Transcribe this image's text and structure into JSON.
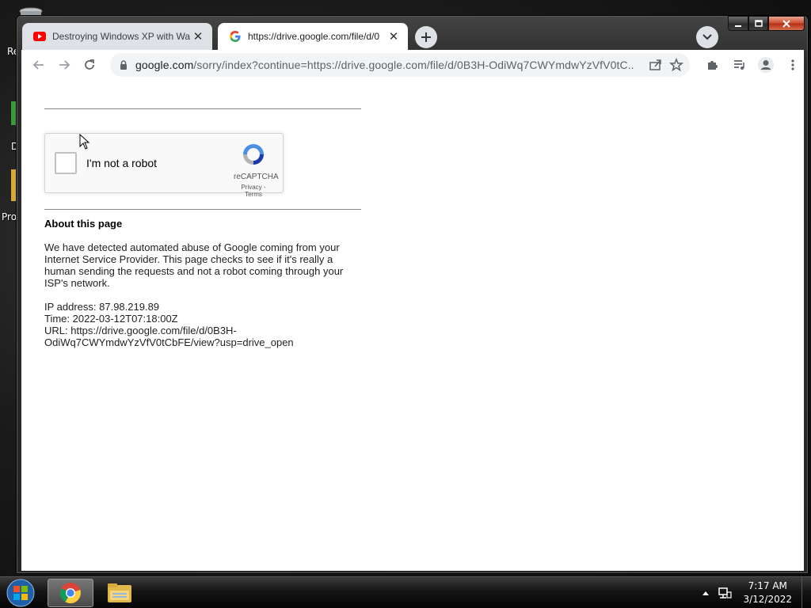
{
  "desktop": {
    "labels": [
      "Re",
      "D",
      "Pro"
    ]
  },
  "browser": {
    "tabs": [
      {
        "title": "Destroying Windows XP with Wa",
        "favicon": "youtube-icon",
        "active": false
      },
      {
        "title": "https://drive.google.com/file/d/0",
        "favicon": "google-icon",
        "active": true
      }
    ],
    "new_tab_label": "+",
    "address": {
      "host": "google.com",
      "rest": "/sorry/index?continue=https://drive.google.com/file/d/0B3H-OdiWq7CWYmdwYzVfV0tC..."
    }
  },
  "page": {
    "recaptcha": {
      "label": "I'm not a robot",
      "brand": "reCAPTCHA",
      "links": "Privacy - Terms"
    },
    "about_title": "About this page",
    "paragraph": "We have detected automated abuse of Google coming from your Internet Service Provider. This page checks to see if it's really a human sending the requests and not a robot coming through your ISP's network.",
    "ip_line": "IP address: 87.98.219.89",
    "time_line": "Time: 2022-03-12T07:18:00Z",
    "url_line": "URL: https://drive.google.com/file/d/0B3H-OdiWq7CWYmdwYzVfV0tCbFE/view?usp=drive_open"
  },
  "taskbar": {
    "time": "7:17 AM",
    "date": "3/12/2022"
  },
  "colors": {
    "youtube_red": "#ff0000",
    "recaptcha_blue": "#1c3aa9",
    "recaptcha_light": "#4a90e2"
  }
}
